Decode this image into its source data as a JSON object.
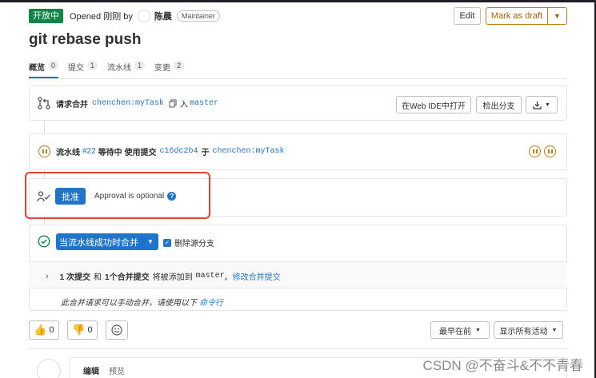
{
  "header": {
    "status": "开放中",
    "opened_text": "Opened 刚刚 by",
    "author": "陈晨",
    "role": "Maintainer",
    "edit_label": "Edit",
    "draft_label": "Mark as draft",
    "title": "git rebase push"
  },
  "tabs": [
    {
      "label": "概览",
      "count": "0"
    },
    {
      "label": "提交",
      "count": "1"
    },
    {
      "label": "流水线",
      "count": "1"
    },
    {
      "label": "变更",
      "count": "2"
    }
  ],
  "merge_request": {
    "prefix": "请求合并",
    "source": "chenchen:myTask",
    "into": "入",
    "target": "master",
    "open_web_ide": "在Web IDE中打开",
    "checkout": "检出分支"
  },
  "pipeline": {
    "label": "流水线",
    "id": "#22",
    "state": "等待中 使用提交",
    "commit": "c16dc2b4",
    "on": "于",
    "branch": "chenchen:myTask"
  },
  "approval": {
    "button": "批准",
    "text": "Approval is optional",
    "help": "?"
  },
  "merge": {
    "button": "当流水线成功时合并",
    "delete_source": "删除源分支",
    "commits_a": "1 次提交",
    "and": "和",
    "commits_b": "1个合并提交",
    "will_add": "将被添加到",
    "target": "master",
    "period": "。",
    "edit_link": "修改合并提交",
    "manual_text": "此合并请求可以手动合并，请使用以下",
    "cmd_link": "命令行"
  },
  "reactions": {
    "thumbs_up": "0",
    "thumbs_down": "0"
  },
  "sort": {
    "oldest": "最早在前",
    "show_all": "显示所有活动"
  },
  "editor_tabs": {
    "edit": "编辑",
    "preview": "预览"
  },
  "watermark": "CSDN @不奋斗&不不青春",
  "colors": {
    "accent": "#1f75cb",
    "status_green": "#108548",
    "warning": "#c17d10",
    "highlight_box": "#e8412e"
  }
}
